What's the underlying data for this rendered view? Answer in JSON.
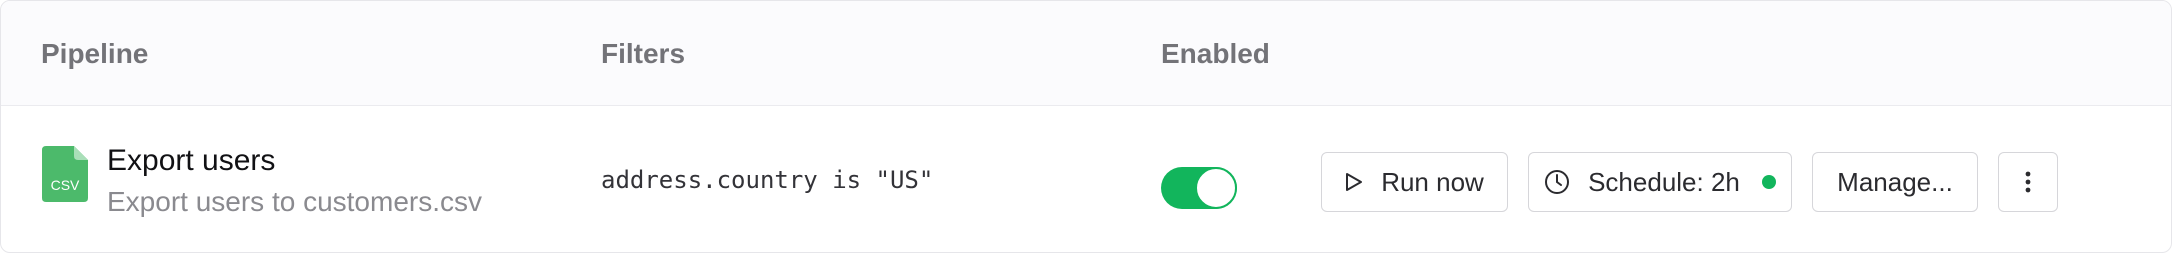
{
  "header": {
    "pipeline": "Pipeline",
    "filters": "Filters",
    "enabled": "Enabled"
  },
  "row": {
    "file_icon_label": "CSV",
    "file_icon_name": "csv-file-icon",
    "name": "Export users",
    "description": "Export users to customers.csv",
    "filter": "address.country is \"US\"",
    "enabled": true,
    "actions": {
      "run_label": "Run now",
      "schedule_label": "Schedule: 2h",
      "manage_label": "Manage...",
      "more_icon": "vertical-ellipsis-icon"
    }
  },
  "colors": {
    "accent_green": "#12b55c",
    "csv_icon": "#4cba6b",
    "status_dot": "#12b55c"
  }
}
